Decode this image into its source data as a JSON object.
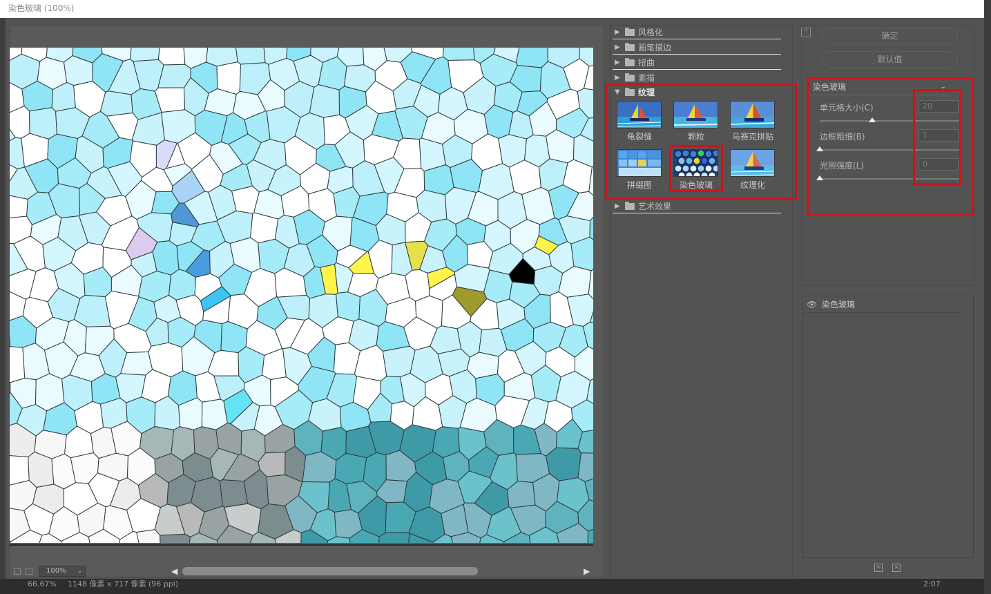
{
  "title": "染色玻璃 (100%)",
  "status_bar": {
    "left": "66.67%",
    "dims": "1148 像素 x 717 像素 (96 ppi)",
    "right": "2:07"
  },
  "preview": {
    "zoom": "100%",
    "zoom_options": [
      "100%"
    ]
  },
  "filter_categories": [
    {
      "name": "风格化",
      "expanded": false
    },
    {
      "name": "画笔描边",
      "expanded": false
    },
    {
      "name": "扭曲",
      "expanded": false
    },
    {
      "name": "素描",
      "expanded": false
    },
    {
      "name": "纹理",
      "expanded": true
    },
    {
      "name": "艺术效果",
      "expanded": false
    }
  ],
  "texture_filters": [
    {
      "name": "龟裂缝",
      "icon": "sailboat-thumbnail"
    },
    {
      "name": "颗粒",
      "icon": "sailboat-thumbnail"
    },
    {
      "name": "马赛克拼贴",
      "icon": "sailboat-thumbnail"
    },
    {
      "name": "拼缀图",
      "icon": "patchwork-thumbnail"
    },
    {
      "name": "染色玻璃",
      "icon": "stained-glass-thumbnail",
      "selected": true
    },
    {
      "name": "纹理化",
      "icon": "sailboat-thumbnail"
    }
  ],
  "buttons": {
    "ok": "确定",
    "default": "默认值"
  },
  "settings": {
    "filter": "染色玻璃",
    "params": [
      {
        "label": "单元格大小(C)",
        "value": "20",
        "level": 0.375
      },
      {
        "label": "边框粗细(B)",
        "value": "1",
        "level": 0.0
      },
      {
        "label": "光照强度(L)",
        "value": "0",
        "level": 0.0
      }
    ]
  },
  "layers": [
    {
      "name": "染色玻璃",
      "visible": true
    }
  ],
  "colors": {
    "highlight": "#d0121b",
    "panel": "#535353"
  }
}
